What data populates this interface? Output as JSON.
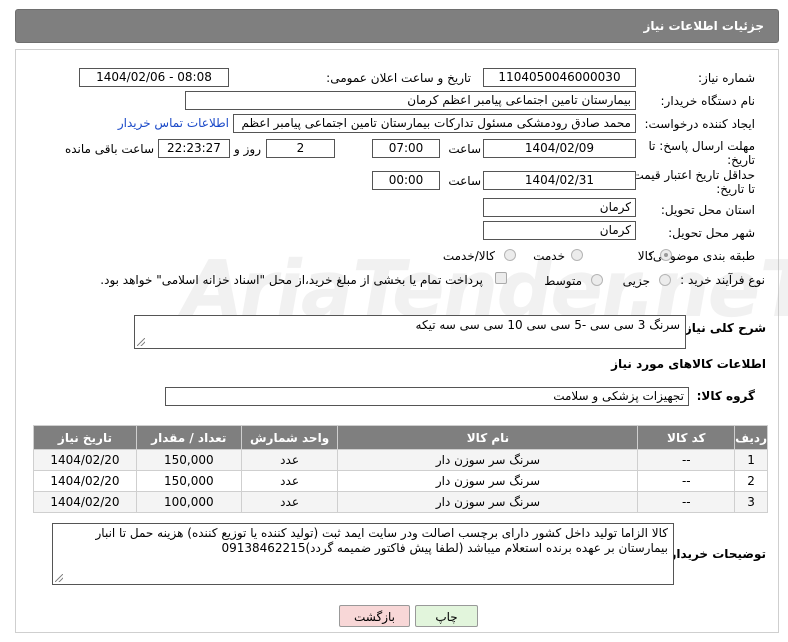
{
  "header": {
    "title": "جزئیات اطلاعات نیاز"
  },
  "form": {
    "need_number": {
      "label": "شماره نیاز:",
      "value": "1104050046000030"
    },
    "announce_datetime": {
      "label": "تاریخ و ساعت اعلان عمومی:",
      "value": "1404/02/06 - 08:08"
    },
    "buyer_org": {
      "label": "نام دستگاه خریدار:",
      "value": "بیمارستان تامین اجتماعی پیامبر اعظم کرمان"
    },
    "requester": {
      "label": "ایجاد کننده درخواست:",
      "value": "محمد صادق  رودمشکی مسئول تدارکات بیمارستان تامین اجتماعی پیامبر اعظم",
      "link": "اطلاعات تماس خریدار"
    },
    "response_deadline": {
      "label_line1": "مهلت ارسال پاسخ: تا",
      "label_line2": "تاریخ:",
      "date": "1404/02/09",
      "time_label": "ساعت",
      "time": "07:00",
      "days": "2",
      "days_label": "روز و",
      "remaining": "22:23:27",
      "remaining_label": "ساعت باقی مانده"
    },
    "price_validity": {
      "label_line1": "حداقل تاریخ اعتبار قیمت:",
      "label_line2": "تا تاریخ:",
      "date": "1404/02/31",
      "time_label": "ساعت",
      "time": "00:00"
    },
    "delivery_province": {
      "label": "استان محل تحویل:",
      "value": "کرمان"
    },
    "delivery_city": {
      "label": "شهر محل تحویل:",
      "value": "کرمان"
    },
    "category": {
      "label": "طبقه بندی موضوعی:",
      "options": [
        "کالا",
        "خدمت",
        "کالا/خدمت"
      ],
      "selected": "کالا"
    },
    "process_type": {
      "label": "نوع فرآیند خرید :",
      "options": [
        "جزیی",
        "متوسط"
      ],
      "selected": "جزیی",
      "checkbox_text": "پرداخت تمام یا بخشی از مبلغ خرید،از محل \"اسناد خزانه اسلامی\" خواهد بود."
    }
  },
  "description": {
    "label": "شرح کلی نیاز:",
    "value": "سرنگ 3 سی سی -5 سی سی 10 سی سی سه تیکه"
  },
  "goods_section": {
    "title": "اطلاعات کالاهای مورد نیاز"
  },
  "goods_group": {
    "label": "گروه کالا:",
    "value": "تجهیزات پزشکی و سلامت"
  },
  "table": {
    "headers": [
      "ردیف",
      "کد کالا",
      "نام کالا",
      "واحد شمارش",
      "تعداد / مقدار",
      "تاریخ نیاز"
    ],
    "rows": [
      {
        "idx": "1",
        "code": "--",
        "name": "سرنگ سر سوزن دار",
        "unit": "عدد",
        "qty": "150,000",
        "date": "1404/02/20"
      },
      {
        "idx": "2",
        "code": "--",
        "name": "سرنگ سر سوزن دار",
        "unit": "عدد",
        "qty": "150,000",
        "date": "1404/02/20"
      },
      {
        "idx": "3",
        "code": "--",
        "name": "سرنگ سر سوزن دار",
        "unit": "عدد",
        "qty": "100,000",
        "date": "1404/02/20"
      }
    ]
  },
  "buyer_notes": {
    "label": "توضیحات خریدار:",
    "line1": "کالا الزاما تولید داخل کشور دارای برچسب اصالت ودر سایت ایمد ثبت (تولید کننده یا توزیع کننده) هزینه حمل تا انبار",
    "line2": "بیمارستان بر عهده برنده استعلام میباشد (لطفا پیش فاکتور ضمیمه گردد)09138462215"
  },
  "buttons": {
    "print": "چاپ",
    "back": "بازگشت"
  },
  "watermark": "AriaTender.neT",
  "colors": {
    "header_bg": "#7f7f7f",
    "link": "#1a49c8",
    "back_button": "#f8d7d7",
    "print_button": "#e2f5dc"
  }
}
